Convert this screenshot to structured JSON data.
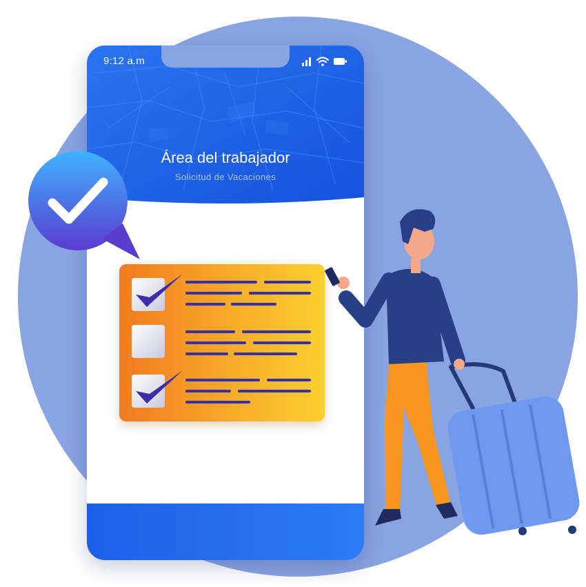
{
  "status_bar": {
    "time": "9:12 a.m",
    "signal_icon": "signal-icon",
    "wifi_icon": "wifi-icon",
    "battery_icon": "battery-icon"
  },
  "header": {
    "title": "Área del trabajador",
    "subtitle": "Solicitud de Vacaciones"
  },
  "checklist": {
    "items": [
      {
        "checked": true
      },
      {
        "checked": false
      },
      {
        "checked": true
      }
    ]
  },
  "colors": {
    "background_circle": "#89a4e2",
    "header_blue": "#1d60e8",
    "card_orange": "#f27a1f",
    "card_yellow": "#fbd02e",
    "checkmark_navy": "#3a2fa8",
    "bubble_gradient_top": "#3fb2ff",
    "bubble_gradient_bottom": "#5a3ccf"
  }
}
